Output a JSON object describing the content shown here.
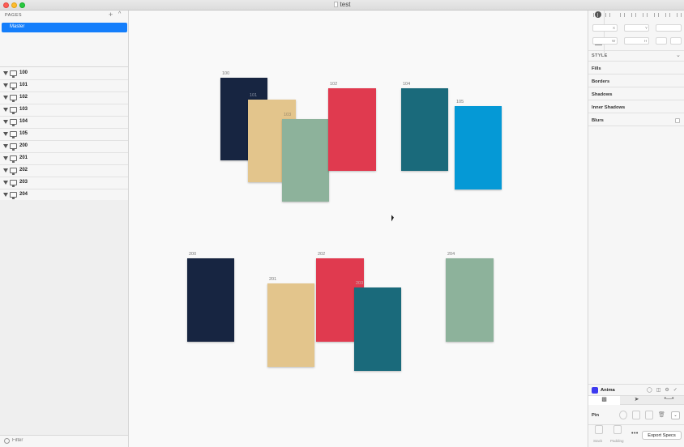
{
  "window": {
    "title": "test"
  },
  "sidebar": {
    "pages_label": "PAGES",
    "add_label": "+",
    "collapse_label": "^",
    "pages": [
      {
        "label": "Master",
        "selected": true
      }
    ],
    "layers": [
      {
        "label": "100"
      },
      {
        "label": "101"
      },
      {
        "label": "102"
      },
      {
        "label": "103"
      },
      {
        "label": "104"
      },
      {
        "label": "105"
      },
      {
        "label": "200"
      },
      {
        "label": "201"
      },
      {
        "label": "202"
      },
      {
        "label": "203"
      },
      {
        "label": "204"
      }
    ],
    "filter_placeholder": "Filter"
  },
  "canvas": {
    "artboard_labels": {
      "a100": "100",
      "a101": "101",
      "a102": "102",
      "a103": "103",
      "a104": "104",
      "a105": "105",
      "a200": "200",
      "a201": "201",
      "a202": "202",
      "a203": "203",
      "a204": "204"
    },
    "colors": {
      "navy": "#172541",
      "sand": "#e3c58c",
      "sage": "#8db29b",
      "red": "#e03a4f",
      "teal": "#1a6a7b",
      "blue": "#0599d6"
    }
  },
  "inspector": {
    "field_labels": {
      "x": "X",
      "y": "Y",
      "w": "W",
      "h": "H"
    },
    "style_label": "STYLE",
    "sections": [
      "Fills",
      "Borders",
      "Shadows",
      "Inner Shadows",
      "Blurs"
    ],
    "anima_label": "Anima",
    "pin_label": "Pin",
    "stack_label": "Stack",
    "padding_label": "Padding",
    "more_label": "•••",
    "export_label": "Export Specs"
  }
}
